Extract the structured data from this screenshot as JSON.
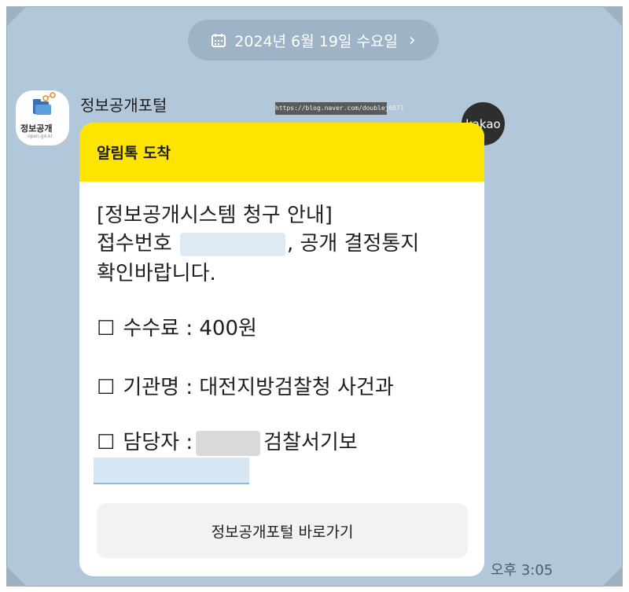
{
  "date_pill": {
    "icon": "calendar-icon",
    "text": "2024년 6월 19일 수요일",
    "chevron": "›"
  },
  "sender": {
    "name": "정보공개포털",
    "avatar_title": "정보공개",
    "avatar_url": "open.go.kr"
  },
  "watermark": "https://blog.naver.com/doublej6871",
  "kakao_badge": "kakao",
  "card": {
    "header": "알림톡 도착",
    "line1": "[정보공개시스템 청구 안내]",
    "line2_prefix": "접수번호",
    "line2_suffix": ", 공개 결정통지",
    "line3": "확인바랍니다.",
    "checkbox_glyph": "☐",
    "fee": "수수료 : 400원",
    "agency": "기관명 : 대전지방검찰청 사건과",
    "officer_prefix": "담당자 :",
    "officer_suffix": "검찰서기보",
    "button_label": "정보공개포털 바로가기"
  },
  "time": "오후 3:05",
  "colors": {
    "chat_background": "#b2c7d9",
    "header_yellow": "#fee500",
    "date_pill": "#9eb3c6"
  }
}
